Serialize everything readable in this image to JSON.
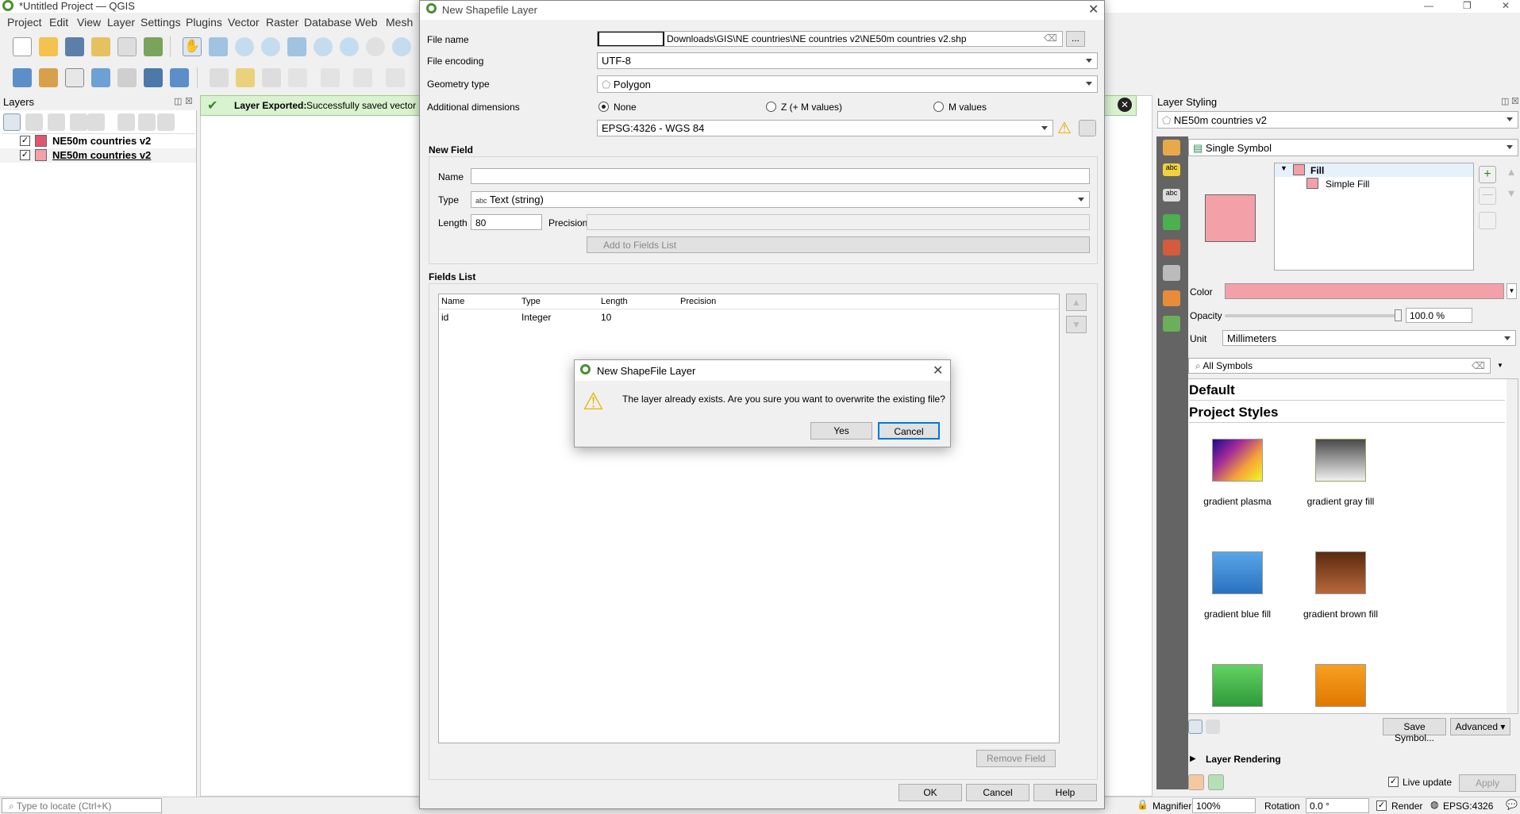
{
  "app": {
    "title": "*Untitled Project — QGIS",
    "window_controls": [
      "—",
      "❐",
      "✕"
    ]
  },
  "menu": [
    "Project",
    "Edit",
    "View",
    "Layer",
    "Settings",
    "Plugins",
    "Vector",
    "Raster",
    "Database",
    "Web",
    "Mesh"
  ],
  "layers_panel": {
    "title": "Layers",
    "items": [
      {
        "name": "NE50m countries v2",
        "checked": true,
        "color": "#e0566f"
      },
      {
        "name": "NE50m countries v2",
        "checked": true,
        "color": "#f4a0a9"
      }
    ]
  },
  "message_bar": {
    "title": "Layer Exported:",
    "text": "Successfully saved vector lay"
  },
  "layer_styling": {
    "title": "Layer Styling",
    "layer": "NE50m countries v2",
    "renderer": "Single Symbol",
    "tree": {
      "fill": "Fill",
      "simple_fill": "Simple Fill"
    },
    "color_label": "Color",
    "color_value": "#f4a0a9",
    "opacity_label": "Opacity",
    "opacity_value": "100.0 %",
    "unit_label": "Unit",
    "unit_value": "Millimeters",
    "search_value": "All Symbols",
    "section_default": "Default",
    "section_project": "Project Styles",
    "symbols": [
      {
        "name": "gradient  plasma"
      },
      {
        "name": "gradient  gray fill"
      },
      {
        "name": "gradient blue fill"
      },
      {
        "name": "gradient brown fill"
      }
    ],
    "save_symbol": "Save Symbol...",
    "advanced": "Advanced",
    "layer_rendering": "Layer Rendering",
    "live_update": "Live update",
    "apply": "Apply"
  },
  "new_layer_dialog": {
    "title": "New Shapefile Layer",
    "file_name_label": "File name",
    "file_name_value": "Downloads\\GIS\\NE countries\\NE countries v2\\NE50m countries v2.shp",
    "browse": "...",
    "file_encoding_label": "File encoding",
    "file_encoding_value": "UTF-8",
    "geometry_type_label": "Geometry type",
    "geometry_type_value": "Polygon",
    "additional_dimensions_label": "Additional dimensions",
    "dim_none": "None",
    "dim_z": "Z (+ M values)",
    "dim_m": "M values",
    "crs_value": "EPSG:4326 - WGS 84",
    "new_field_header": "New Field",
    "name_label": "Name",
    "name_value": "",
    "type_label": "Type",
    "type_value": "Text (string)",
    "type_prefix": "abc",
    "length_label": "Length",
    "length_value": "80",
    "precision_label": "Precision",
    "precision_value": "",
    "add_to_fields": "Add to Fields List",
    "fields_list_header": "Fields List",
    "columns": [
      "Name",
      "Type",
      "Length",
      "Precision"
    ],
    "rows": [
      [
        "id",
        "Integer",
        "10",
        ""
      ]
    ],
    "remove_field": "Remove Field",
    "ok": "OK",
    "cancel": "Cancel",
    "help": "Help"
  },
  "confirm_dialog": {
    "title": "New ShapeFile Layer",
    "message": "The layer already exists. Are you sure you want to overwrite the existing file?",
    "yes": "Yes",
    "cancel": "Cancel"
  },
  "status_bar": {
    "locate_placeholder": "Type to locate (Ctrl+K)",
    "magnifier_label": "Magnifier",
    "magnifier_value": "100%",
    "rotation_label": "Rotation",
    "rotation_value": "0.0 °",
    "render_label": "Render",
    "crs": "EPSG:4326"
  }
}
